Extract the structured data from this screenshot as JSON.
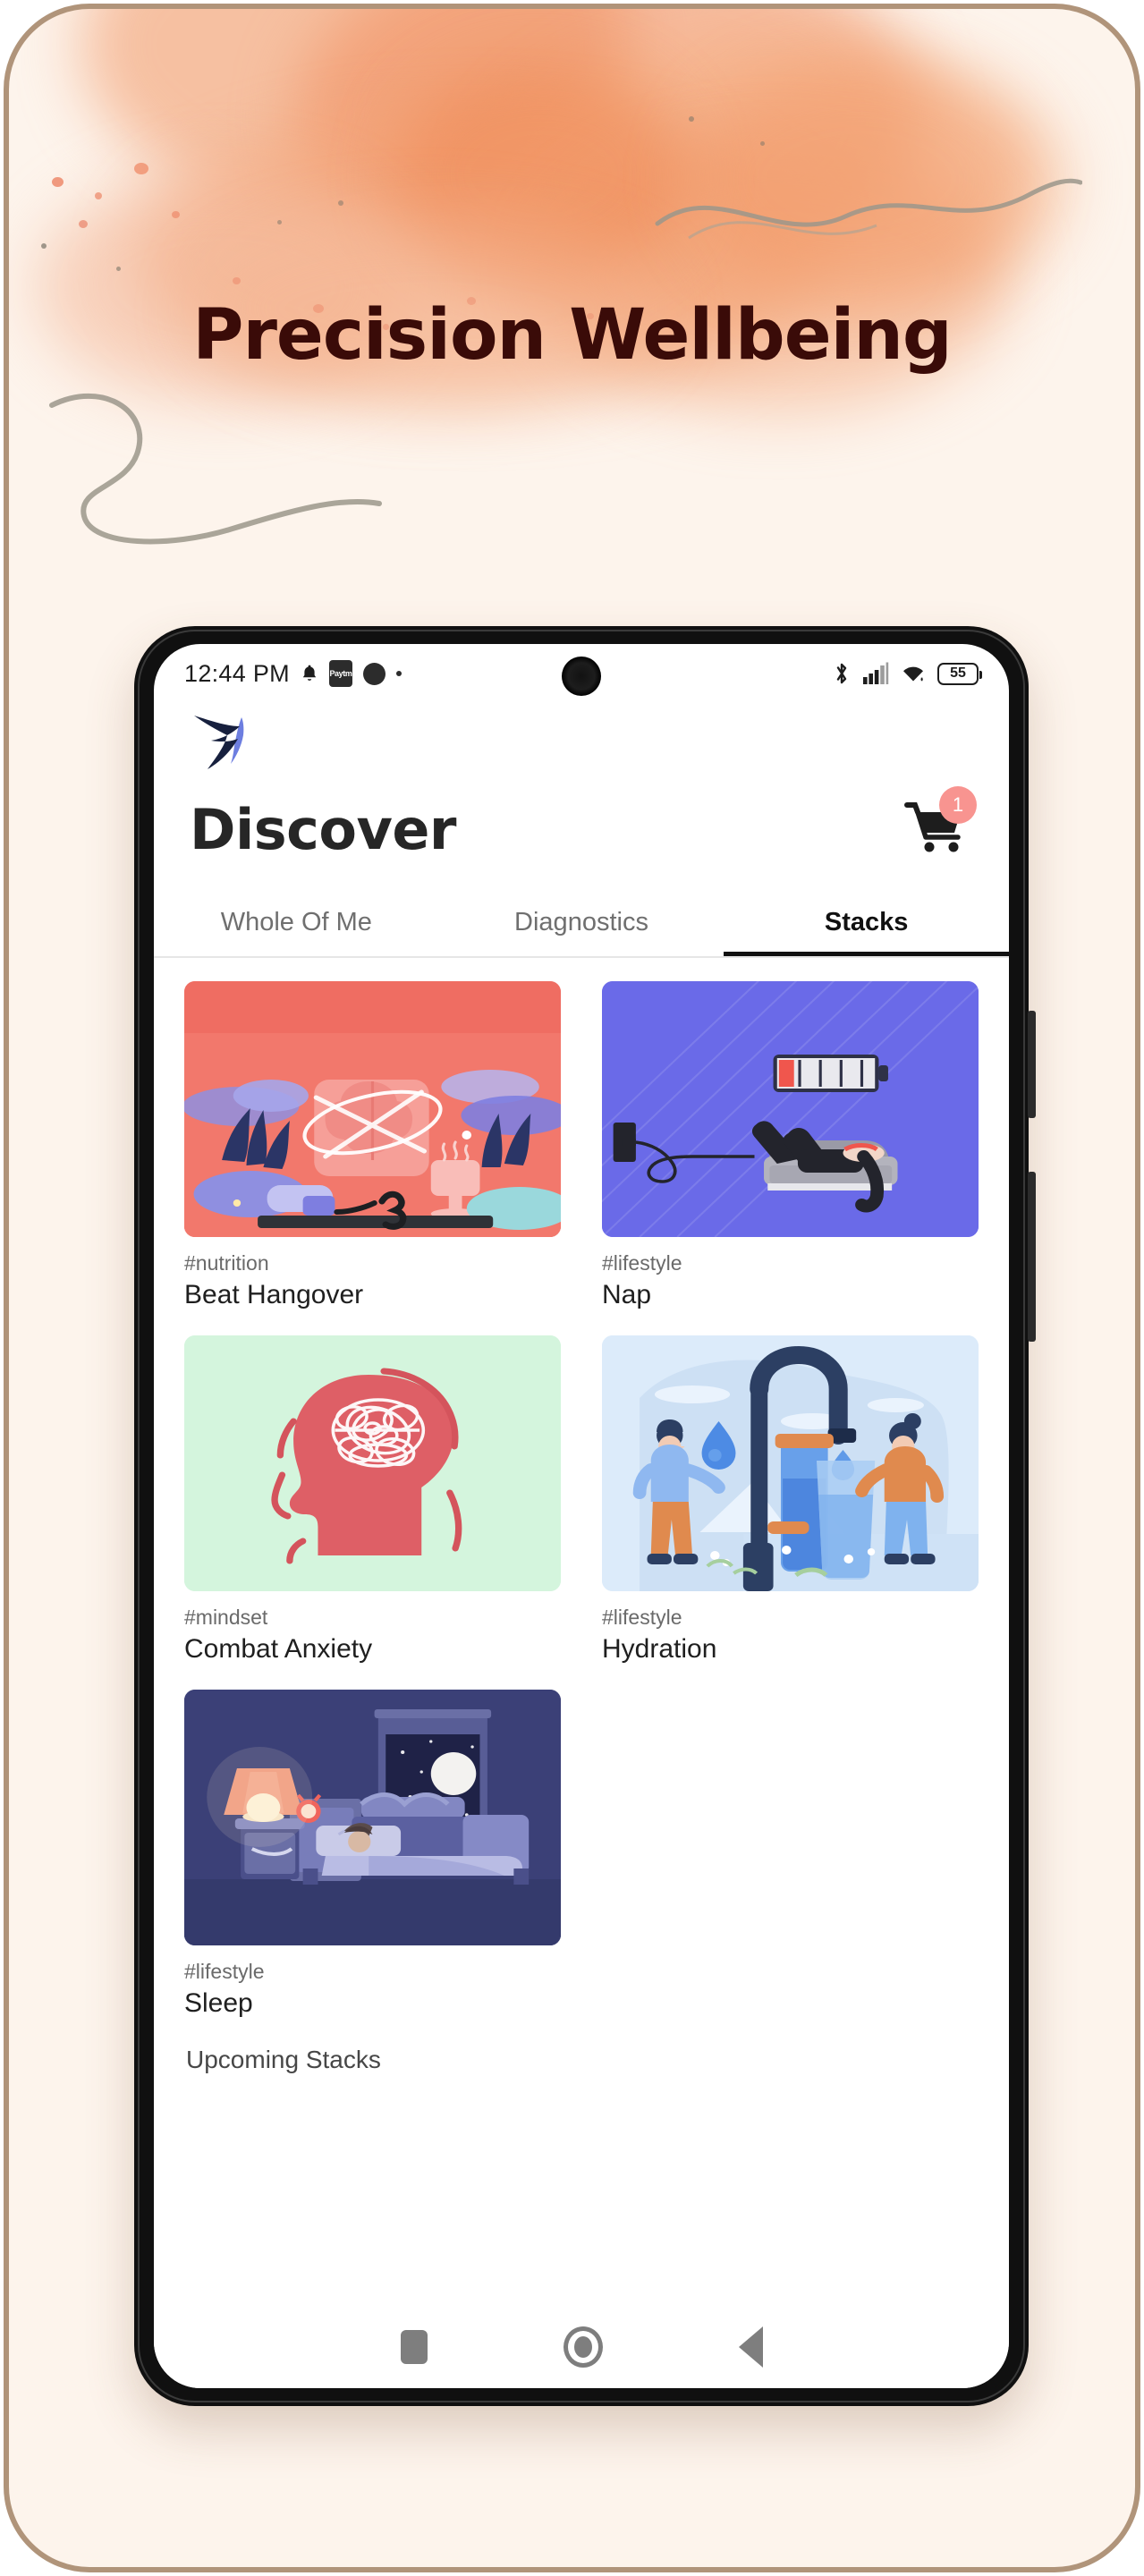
{
  "poster": {
    "banner_title": "Precision Wellbeing",
    "background_color": "#fdf4ec",
    "border_color": "#b0947a",
    "watercolor_color": "#f0a178"
  },
  "phone": {
    "statusbar": {
      "clock": "12:44 PM",
      "icons_left": [
        "bell-icon",
        "paytm-icon",
        "dot-icon",
        "tiny-dot-icon"
      ],
      "paytm_label": "Paytm",
      "icons_right": [
        "bluetooth-icon",
        "signal-icon",
        "wifi-icon"
      ],
      "battery_level": "55"
    },
    "app": {
      "logo_name": "swift-bird-logo",
      "logo_colors": {
        "dark": "#17203e",
        "accent": "#6d7ee0"
      },
      "header": {
        "title": "Discover",
        "cart_icon": "shopping-cart-icon",
        "cart_badge_count": "1",
        "cart_badge_color": "#f89490"
      },
      "tabs": [
        {
          "label": "Whole Of Me",
          "active": false
        },
        {
          "label": "Diagnostics",
          "active": false
        },
        {
          "label": "Stacks",
          "active": true
        }
      ],
      "stacks": [
        {
          "tag": "#nutrition",
          "name": "Beat Hangover",
          "art": "beat-hangover-art",
          "bg": "#ef6d62"
        },
        {
          "tag": "#lifestyle",
          "name": "Nap",
          "art": "nap-art",
          "bg": "#6a6ae8"
        },
        {
          "tag": "#mindset",
          "name": "Combat Anxiety",
          "art": "combat-anxiety-art",
          "bg": "#d4f5dd"
        },
        {
          "tag": "#lifestyle",
          "name": "Hydration",
          "art": "hydration-art",
          "bg": "#d6e8f8"
        },
        {
          "tag": "#lifestyle",
          "name": "Sleep",
          "art": "sleep-art",
          "bg": "#3a3f74"
        }
      ],
      "upcoming_label": "Upcoming Stacks"
    },
    "navbar": {
      "recents": "square-recents-icon",
      "home": "circle-home-icon",
      "back": "triangle-back-icon"
    }
  }
}
